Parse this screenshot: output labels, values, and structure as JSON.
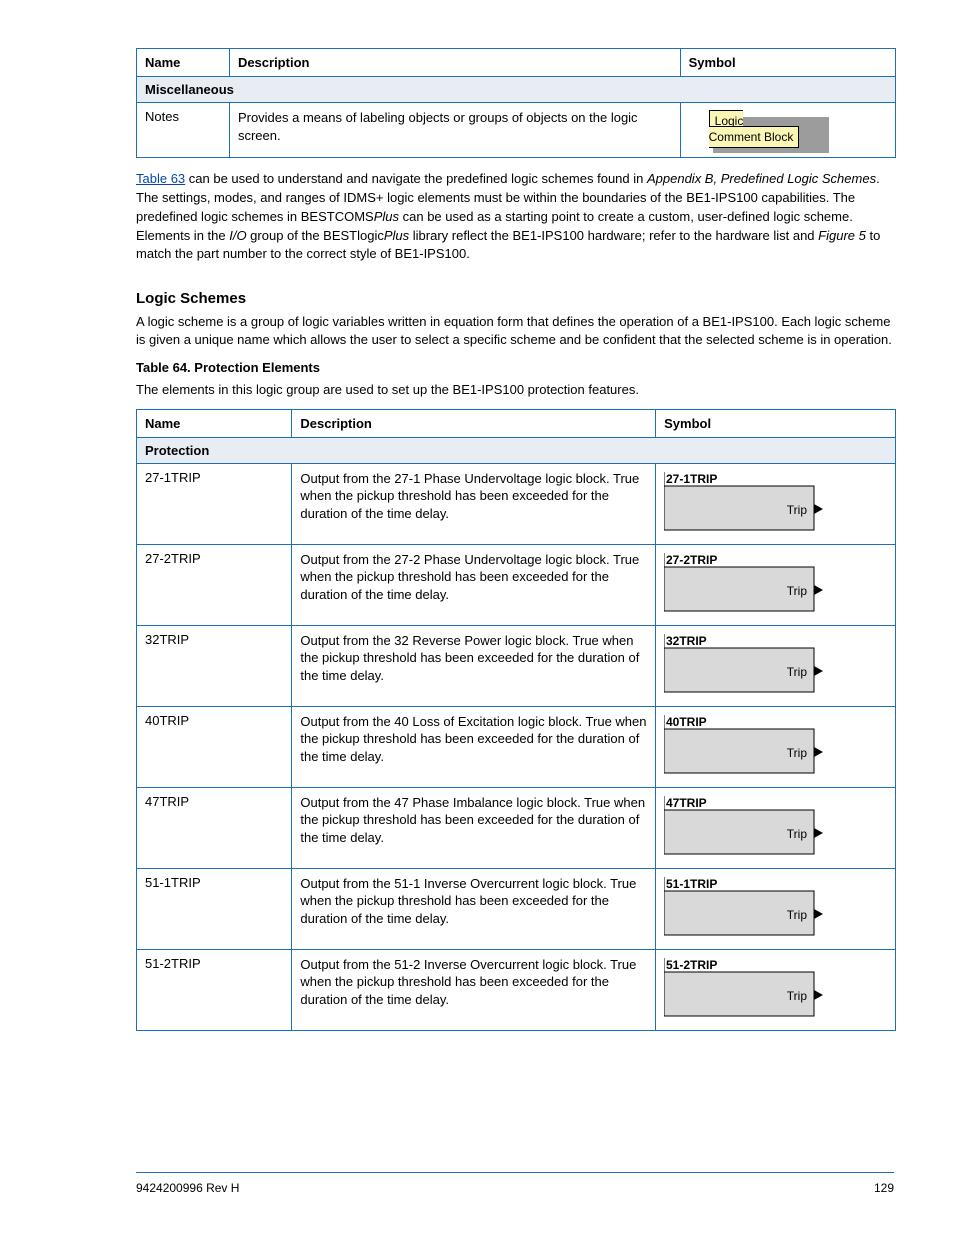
{
  "note_table": {
    "headers": {
      "name": "Name",
      "description": "Description",
      "symbol": "Symbol"
    },
    "section": "Miscellaneous",
    "row": {
      "name": "Notes",
      "description": "Provides a means of labeling objects or groups of objects on the logic screen.",
      "logic_text": "Logic\nComment Block"
    }
  },
  "para": {
    "link_text": "Table 63",
    "text_after_link": " can be used to understand and navigate the predefined logic schemes found in ",
    "appendix": "Appendix B, Predefined Logic Schemes",
    "tail": ". The settings, modes, and ranges of IDMS+ logic elements must be within the boundaries of the BE1-IPS100 capabilities. The predefined logic schemes in BESTCOMS",
    "em1": "Plus",
    "tail2": " can be used as a starting point to create a custom, user-defined logic scheme. Elements in the ",
    "em2": "I/O",
    "tail3": " group of the BESTlogic",
    "em3": "Plus",
    "tail4": " library reflect the BE1-IPS100 hardware; refer to the hardware list and ",
    "em4": "Figure 5",
    "tail5": " to match the part number to the correct style of BE1-IPS100."
  },
  "subhead": "Logic Schemes",
  "subpara1": "A logic scheme is a group of logic variables written in equation form that defines the operation of a BE1-IPS100. Each logic scheme is given a unique name which allows the user to select a specific scheme and be confident that the selected scheme is in operation.",
  "caption": "Table 64. Protection Elements",
  "subpara2": "The elements in this logic group are used to set up the BE1-IPS100 protection features.",
  "prot_table": {
    "headers": {
      "name": "Name",
      "description": "Description",
      "symbol": "Symbol"
    },
    "section": "Protection",
    "rows": [
      {
        "name": "27-1TRIP",
        "desc": "Output from the 27-1 Phase Undervoltage logic block. True when the pickup threshold has been exceeded for the duration of the time delay.",
        "label": "27-1TRIP"
      },
      {
        "name": "27-2TRIP",
        "desc": "Output from the 27-2 Phase Undervoltage logic block. True when the pickup threshold has been exceeded for the duration of the time delay.",
        "label": "27-2TRIP"
      },
      {
        "name": "32TRIP",
        "desc": "Output from the 32 Reverse Power logic block. True when the pickup threshold has been exceeded for the duration of the time delay.",
        "label": "32TRIP"
      },
      {
        "name": "40TRIP",
        "desc": "Output from the 40 Loss of Excitation logic block. True when the pickup threshold has been exceeded for the duration of the time delay.",
        "label": "40TRIP"
      },
      {
        "name": "47TRIP",
        "desc": "Output from the 47 Phase Imbalance logic block. True when the pickup threshold has been exceeded for the duration of the time delay.",
        "label": "47TRIP"
      },
      {
        "name": "51-1TRIP",
        "desc": "Output from the 51-1 Inverse Overcurrent logic block. True when the pickup threshold has been exceeded for the duration of the time delay.",
        "label": "51-1TRIP"
      },
      {
        "name": "51-2TRIP",
        "desc": "Output from the 51-2 Inverse Overcurrent logic block. True when the pickup threshold has been exceeded for the duration of the time delay.",
        "label": "51-2TRIP"
      }
    ],
    "trip_text": "Trip"
  },
  "footer": {
    "left": "9424200996 Rev H",
    "right": "129"
  }
}
